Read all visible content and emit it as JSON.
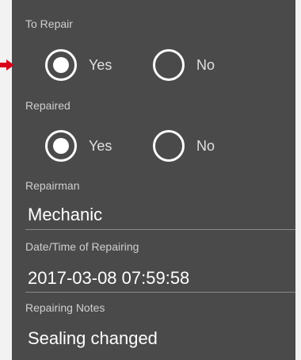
{
  "to_repair": {
    "label": "To Repair",
    "options": [
      {
        "label": "Yes",
        "selected": true
      },
      {
        "label": "No",
        "selected": false
      }
    ]
  },
  "repaired": {
    "label": "Repaired",
    "options": [
      {
        "label": "Yes",
        "selected": true
      },
      {
        "label": "No",
        "selected": false
      }
    ]
  },
  "repairman": {
    "label": "Repairman",
    "value": "Mechanic"
  },
  "repair_datetime": {
    "label": "Date/Time of Repairing",
    "value": "2017-03-08 07:59:58"
  },
  "notes": {
    "label": "Repairing Notes",
    "value": "Sealing changed"
  },
  "colors": {
    "panel": "#4a4a4a",
    "arrow": "#d9001b",
    "page": "#f2f2f2"
  }
}
